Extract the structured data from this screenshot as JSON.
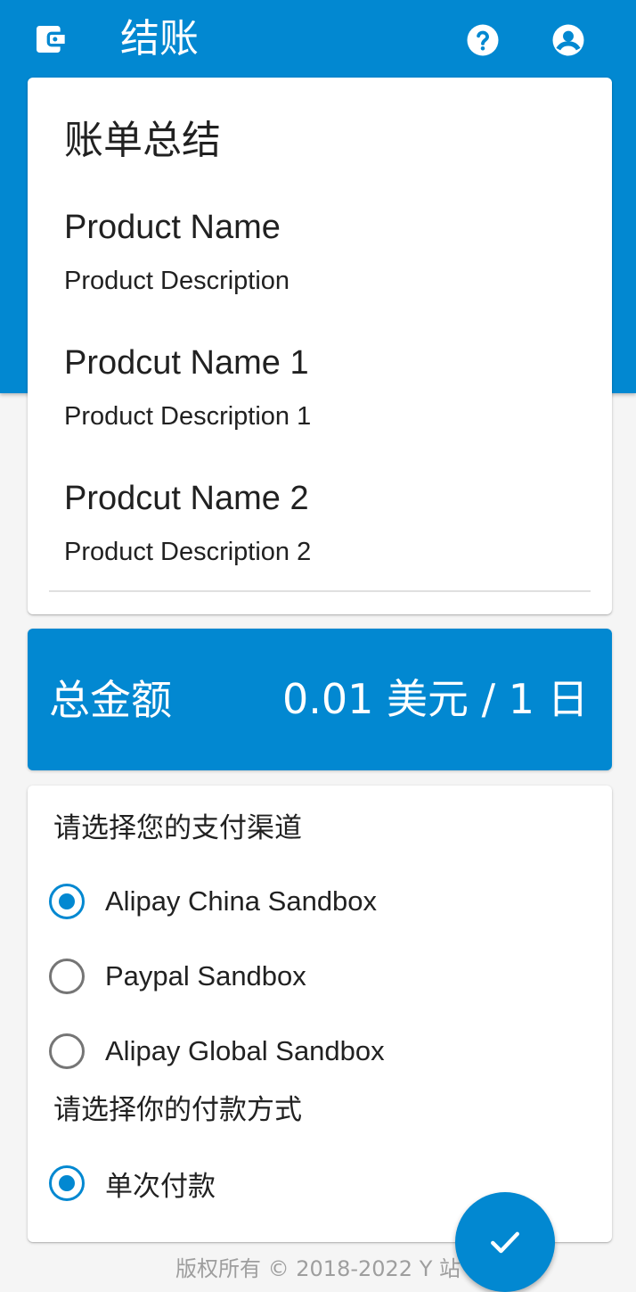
{
  "app": {
    "title": "结账"
  },
  "toolbar": {
    "wallet_icon": "wallet-icon",
    "help_icon": "help-icon",
    "account_icon": "account-circle-icon"
  },
  "summary": {
    "title": "账单总结",
    "items": [
      {
        "name": "Product Name",
        "description": "Product Description"
      },
      {
        "name": "Prodcut Name 1",
        "description": "Product Description 1"
      },
      {
        "name": "Prodcut Name 2",
        "description": "Product Description 2"
      }
    ]
  },
  "total": {
    "label": "总金额",
    "amount": "0.01 美元 / 1 日"
  },
  "payment": {
    "channel_label": "请选择您的支付渠道",
    "channels": [
      {
        "label": "Alipay China Sandbox",
        "selected": true
      },
      {
        "label": "Paypal Sandbox",
        "selected": false
      },
      {
        "label": "Alipay Global Sandbox",
        "selected": false
      }
    ],
    "method_label": "请选择你的付款方式",
    "methods": [
      {
        "label": "单次付款",
        "selected": true
      }
    ]
  },
  "footer": {
    "text": "版权所有 © 2018-2022 Y 站"
  },
  "fab": {
    "icon": "check-icon"
  },
  "colors": {
    "primary": "#0288d1",
    "background": "#f5f5f5",
    "radio_unchecked": "#757575"
  }
}
